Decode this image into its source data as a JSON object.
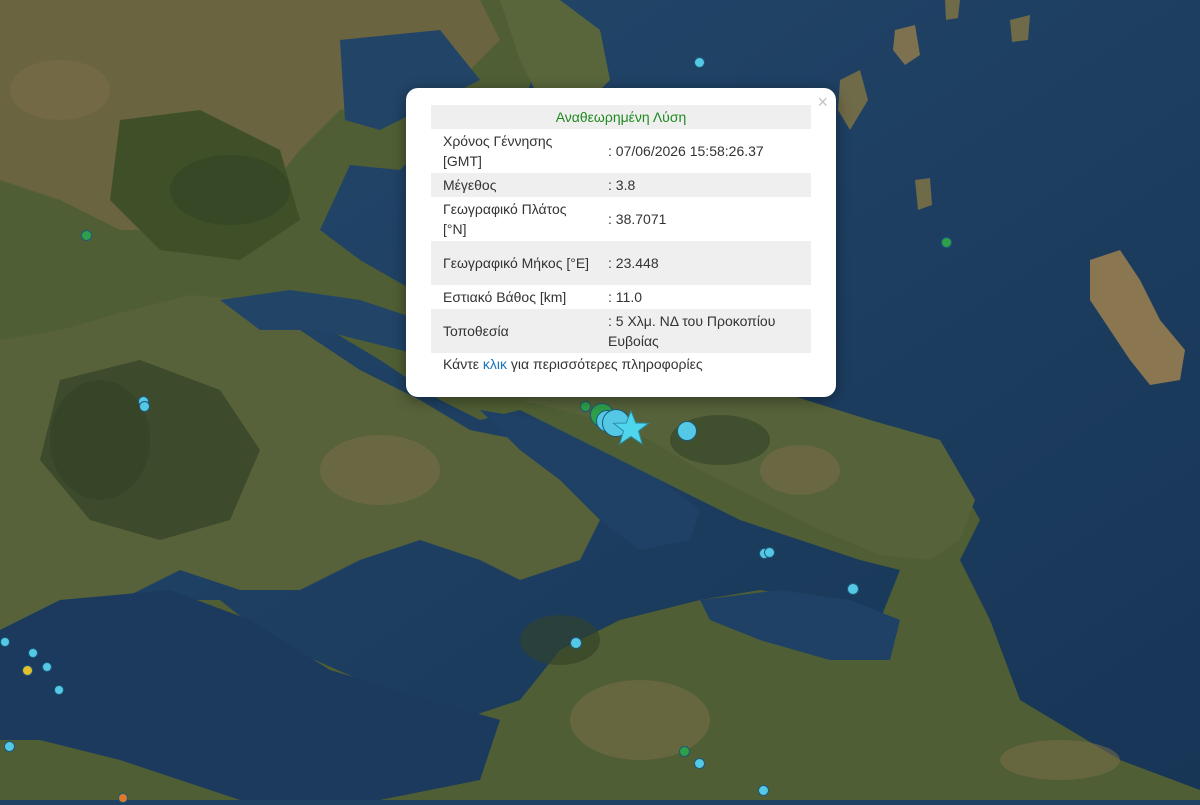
{
  "popup": {
    "title": "Αναθεωρημένη Λύση",
    "close_symbol": "×",
    "rows": [
      {
        "label": "Χρόνος Γέννησης [GMT]",
        "value": ": 07/06/2026 15:58:26.37"
      },
      {
        "label": "Μέγεθος",
        "value": ": 3.8"
      },
      {
        "label": "Γεωγραφικό Πλάτος [°N]",
        "value": ": 38.7071"
      },
      {
        "label": "Γεωγραφικό Μήκος [°E]",
        "value": ": 23.448"
      },
      {
        "label": "Εστιακό Βάθος [km]",
        "value": ": 11.0"
      },
      {
        "label": "Τοποθεσία",
        "value": ": 5 Χλμ. ΝΔ του Προκοπίου Ευβοίας"
      }
    ],
    "more_prefix": "Κάντε ",
    "more_link": "κλικ",
    "more_suffix": " για περισσότερες πληροφορίες"
  },
  "colors": {
    "recent": "#55c8e6",
    "older": "#2ea04a",
    "yellow": "#e5c02a",
    "orange": "#e07a2a",
    "star": "#4fd6ec",
    "title_green": "#1f8a1f",
    "link_blue": "#1a73b8"
  },
  "icons": {
    "main_event": "star-icon",
    "other_events": "circle-marker-icon",
    "close": "close-icon"
  }
}
